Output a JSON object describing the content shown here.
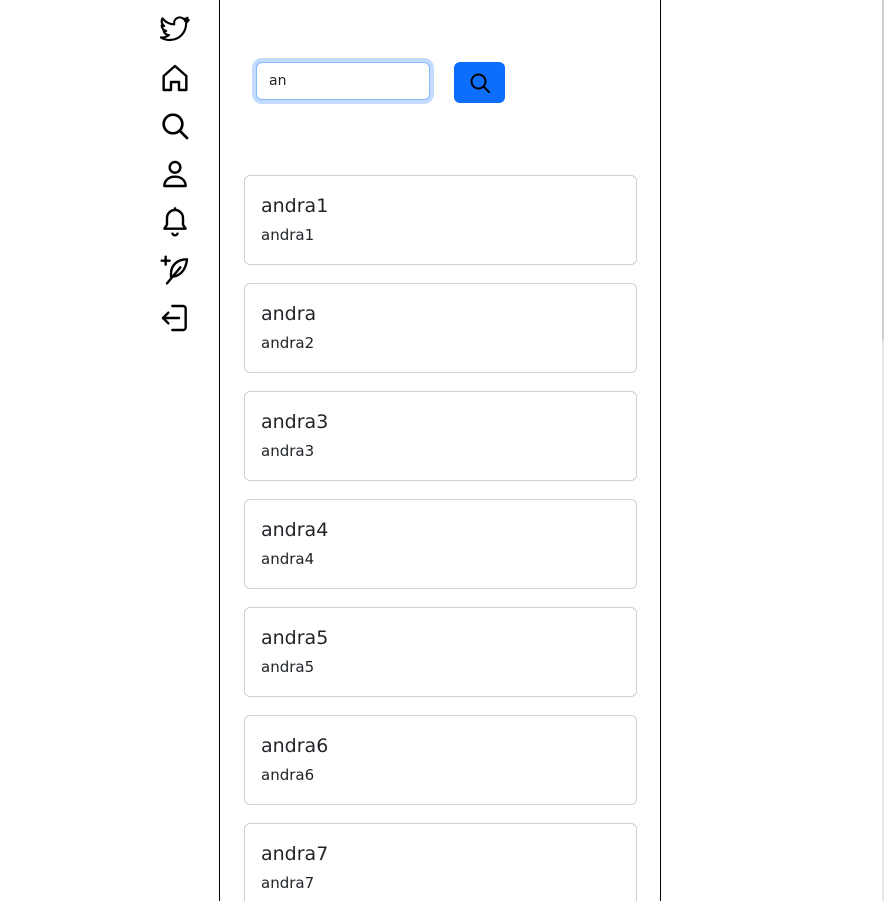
{
  "sidebar": {
    "items": [
      {
        "icon": "twitter-icon"
      },
      {
        "icon": "home-icon"
      },
      {
        "icon": "search-icon"
      },
      {
        "icon": "profile-icon"
      },
      {
        "icon": "bell-icon"
      },
      {
        "icon": "new-tweet-icon"
      },
      {
        "icon": "logout-icon"
      }
    ]
  },
  "search": {
    "value": "an",
    "button_icon": "search-icon",
    "button_color": "#0d6efd"
  },
  "results": [
    {
      "name": "andra1",
      "handle": "andra1"
    },
    {
      "name": "andra",
      "handle": "andra2"
    },
    {
      "name": "andra3",
      "handle": "andra3"
    },
    {
      "name": "andra4",
      "handle": "andra4"
    },
    {
      "name": "andra5",
      "handle": "andra5"
    },
    {
      "name": "andra6",
      "handle": "andra6"
    },
    {
      "name": "andra7",
      "handle": "andra7"
    }
  ]
}
